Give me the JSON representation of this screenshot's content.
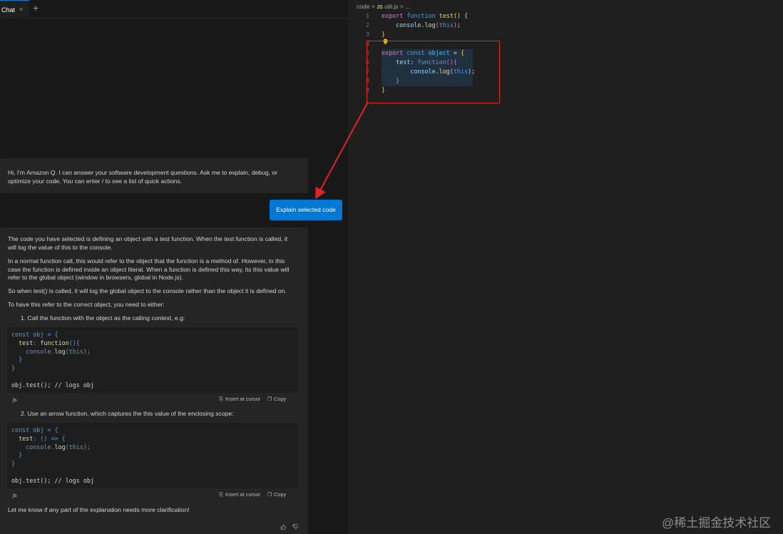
{
  "tabs": {
    "active_label": "Chat",
    "close_glyph": "×",
    "add_glyph": "+"
  },
  "greeting": {
    "line1": "Hi, I'm Amazon Q. I can answer your software development questions. Ask me to explain, debug, or",
    "line2": "optimize your code. You can enter  /  to see a list of quick actions."
  },
  "user_message": "Explain selected code",
  "answer": {
    "p1_line1": "The code you have selected is defining an object with a test function. When the test function is called, it",
    "p1_line2": "will log the value of this to the console.",
    "p2_line1": "In a normal function call, this would refer to the object that the function is a method of. However, in this",
    "p2_line2": "case the function is defined inside an object literal. When a function is defined this way, its this value will",
    "p2_line3": "refer to the global object (window in browsers, global in Node.js).",
    "p3": "So when test() is called, it will log the global object to the console rather than the object it is defined on.",
    "p4": "To have this refer to the correct object, you need to either:",
    "item1": "1. Call the function with the object as the calling context, e.g:",
    "item2": "2. Use an arrow function, which captures the this value of the enclosing scope:",
    "closing": "Let me know if any part of the explanation needs more clarification!"
  },
  "code_blocks": [
    {
      "lang": "js",
      "insert_label": "Insert at cursor",
      "copy_label": "Copy",
      "call_line": "obj.test(); // logs obj"
    },
    {
      "lang": "js",
      "insert_label": "Insert at cursor",
      "copy_label": "Copy",
      "call_line": "obj.test(); // logs obj"
    }
  ],
  "editor": {
    "breadcrumb_folder": "code",
    "breadcrumb_sep": ">",
    "breadcrumb_lang_badge": "JS",
    "breadcrumb_file": "util.js",
    "breadcrumb_more": "...",
    "line_numbers": [
      "1",
      "2",
      "3",
      "4",
      "5",
      "6",
      "7",
      "8",
      "9"
    ]
  },
  "icons": {
    "thumbs_up": "thumbs-up-icon",
    "thumbs_down": "thumbs-down-icon",
    "insert": "insert-at-cursor-icon",
    "copy": "copy-icon",
    "lightbulb": "lightbulb-icon"
  },
  "colors": {
    "accent_blue": "#0078d4",
    "annotation_red": "#e02424"
  },
  "watermark": "@稀土掘金技术社区"
}
